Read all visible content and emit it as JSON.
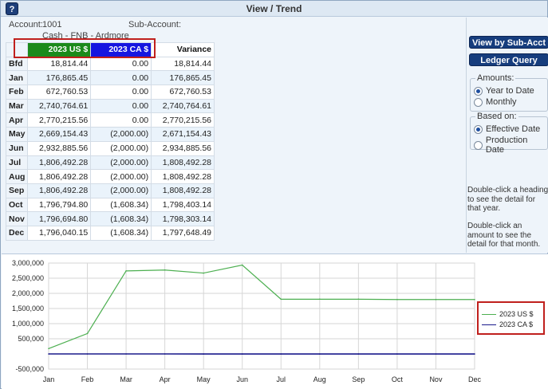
{
  "window": {
    "title": "View / Trend",
    "icon": "help-icon",
    "icon_glyph": "?"
  },
  "account": {
    "label": "Account:",
    "value": "1001",
    "sub_label": "Sub-Account:",
    "name": "Cash - FNB - Ardmore"
  },
  "grid": {
    "headers": {
      "us": "2023 US $",
      "ca": "2023 CA $",
      "variance": "Variance"
    },
    "rows": [
      {
        "label": "Bfd",
        "us": "18,814.44",
        "ca": "0.00",
        "variance": "18,814.44"
      },
      {
        "label": "Jan",
        "us": "176,865.45",
        "ca": "0.00",
        "variance": "176,865.45"
      },
      {
        "label": "Feb",
        "us": "672,760.53",
        "ca": "0.00",
        "variance": "672,760.53"
      },
      {
        "label": "Mar",
        "us": "2,740,764.61",
        "ca": "0.00",
        "variance": "2,740,764.61"
      },
      {
        "label": "Apr",
        "us": "2,770,215.56",
        "ca": "0.00",
        "variance": "2,770,215.56"
      },
      {
        "label": "May",
        "us": "2,669,154.43",
        "ca": "(2,000.00)",
        "variance": "2,671,154.43"
      },
      {
        "label": "Jun",
        "us": "2,932,885.56",
        "ca": "(2,000.00)",
        "variance": "2,934,885.56"
      },
      {
        "label": "Jul",
        "us": "1,806,492.28",
        "ca": "(2,000.00)",
        "variance": "1,808,492.28"
      },
      {
        "label": "Aug",
        "us": "1,806,492.28",
        "ca": "(2,000.00)",
        "variance": "1,808,492.28"
      },
      {
        "label": "Sep",
        "us": "1,806,492.28",
        "ca": "(2,000.00)",
        "variance": "1,808,492.28"
      },
      {
        "label": "Oct",
        "us": "1,796,794.80",
        "ca": "(1,608.34)",
        "variance": "1,798,403.14"
      },
      {
        "label": "Nov",
        "us": "1,796,694.80",
        "ca": "(1,608.34)",
        "variance": "1,798,303.14"
      },
      {
        "label": "Dec",
        "us": "1,796,040.15",
        "ca": "(1,608.34)",
        "variance": "1,797,648.49"
      }
    ]
  },
  "panel": {
    "view_by_sub_acct": "View by Sub-Acct",
    "ledger_query": "Ledger Query",
    "amounts": {
      "title": "Amounts:",
      "options": [
        "Year to Date",
        "Monthly"
      ],
      "selected": "Year to Date"
    },
    "based_on": {
      "title": "Based on:",
      "options": [
        "Effective Date",
        "Production Date"
      ],
      "selected": "Effective Date"
    },
    "hint_heading": "Double-click a heading to see the detail for that year.",
    "hint_amount": "Double-click an amount to see the detail for that month."
  },
  "colors": {
    "us": "#1b8a1b",
    "ca": "#1515e0",
    "us_line": "#4caf50",
    "ca_line": "#1a1a8c",
    "highlight": "#c0201d"
  },
  "chart_data": {
    "type": "line",
    "x": [
      "Jan",
      "Feb",
      "Mar",
      "Apr",
      "May",
      "Jun",
      "Jul",
      "Aug",
      "Sep",
      "Oct",
      "Nov",
      "Dec"
    ],
    "series": [
      {
        "name": "2023 US $",
        "values": [
          176865.45,
          672760.53,
          2740764.61,
          2770215.56,
          2669154.43,
          2932885.56,
          1806492.28,
          1806492.28,
          1806492.28,
          1796794.8,
          1796694.8,
          1796040.15
        ]
      },
      {
        "name": "2023 CA $",
        "values": [
          0,
          0,
          0,
          0,
          -2000,
          -2000,
          -2000,
          -2000,
          -2000,
          -1608.34,
          -1608.34,
          -1608.34
        ]
      }
    ],
    "yticks": [
      "3,000,000",
      "2,500,000",
      "2,000,000",
      "1,500,000",
      "1,000,000",
      "500,000",
      "-500,000"
    ],
    "ylim": [
      -500000,
      3000000
    ],
    "grid": true,
    "legend": "right"
  }
}
